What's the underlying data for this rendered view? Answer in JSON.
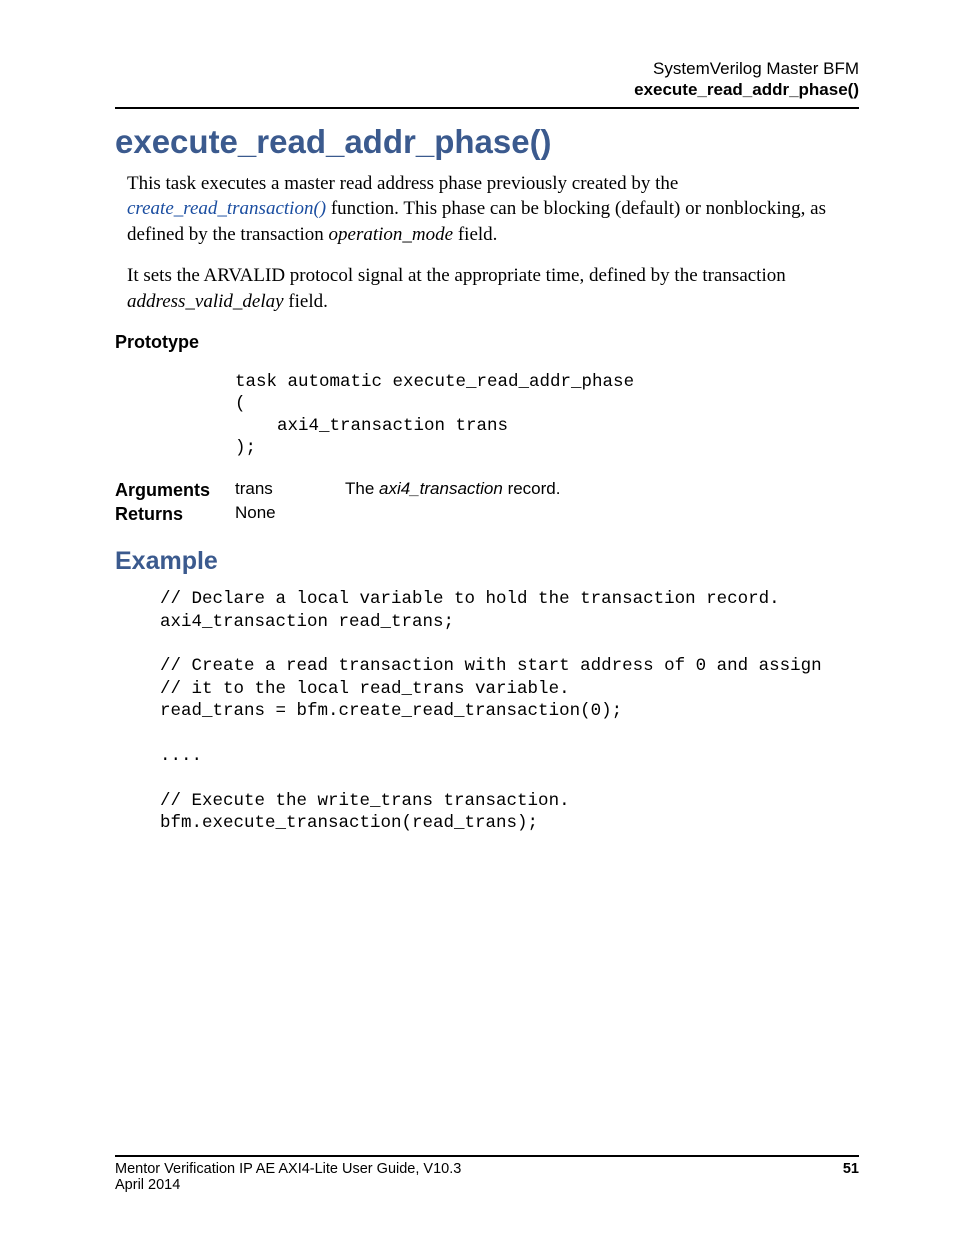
{
  "header": {
    "line1": "SystemVerilog Master BFM",
    "line2": "execute_read_addr_phase()"
  },
  "title": "execute_read_addr_phase()",
  "para1_pre": "This task executes a master read address phase previously created by the ",
  "para1_link": "create_read_transaction()",
  "para1_mid": " function. This phase can be blocking (default) or nonblocking, as defined by the transaction ",
  "para1_em": "operation_mode",
  "para1_post": " field.",
  "para2_pre": "It sets the ARVALID protocol signal at the appropriate time, defined by the transaction ",
  "para2_em": "address_valid_delay",
  "para2_post": " field.",
  "labels": {
    "prototype": "Prototype",
    "arguments": "Arguments",
    "returns": "Returns"
  },
  "prototype_code": "task automatic execute_read_addr_phase\n(\n    axi4_transaction trans\n);",
  "arguments": {
    "name": "trans",
    "desc_pre": "The ",
    "desc_em": "axi4_transaction",
    "desc_post": " record."
  },
  "returns_value": "None",
  "example_heading": "Example",
  "example_code": "// Declare a local variable to hold the transaction record.\naxi4_transaction read_trans;\n\n// Create a read transaction with start address of 0 and assign\n// it to the local read_trans variable.\nread_trans = bfm.create_read_transaction(0);\n\n....\n\n// Execute the write_trans transaction.\nbfm.execute_transaction(read_trans);",
  "footer": {
    "doc_title": "Mentor Verification IP AE AXI4-Lite User Guide, V10.3",
    "date": "April 2014",
    "page": "51"
  }
}
